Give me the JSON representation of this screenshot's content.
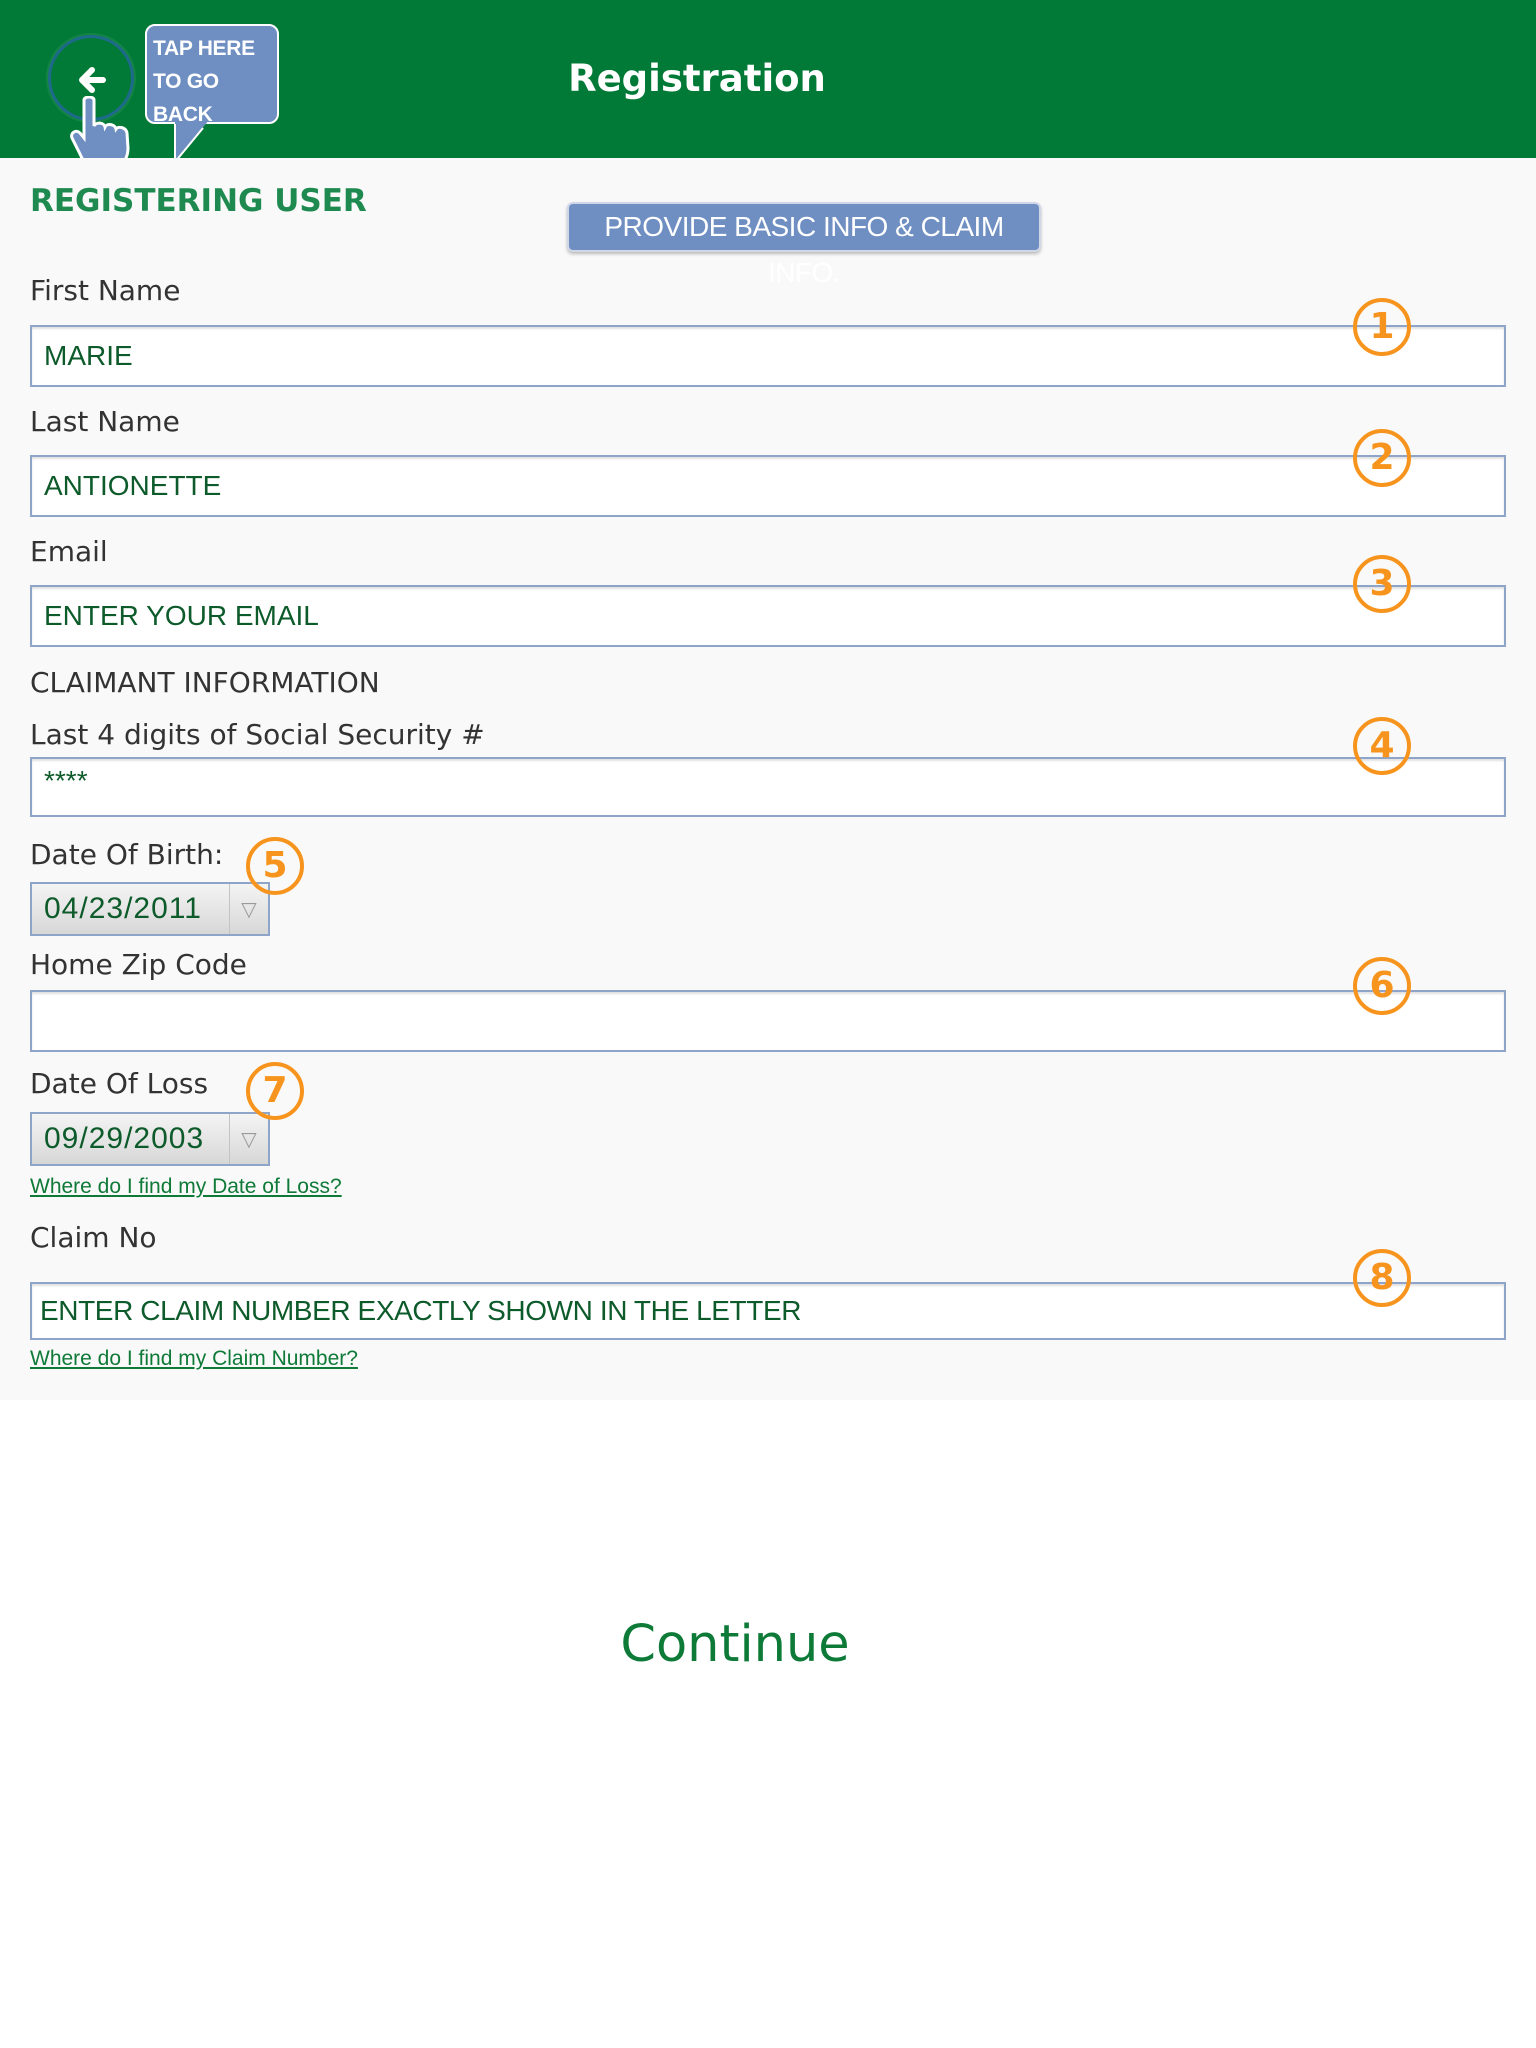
{
  "header": {
    "title": "Registration",
    "tooltip": "TAP HERE TO GO BACK"
  },
  "section_title": "REGISTERING USER",
  "banner": "PROVIDE BASIC INFO & CLAIM INFO.",
  "form": {
    "first_name": {
      "label": "First Name",
      "value": "MARIE",
      "badge": "1"
    },
    "last_name": {
      "label": "Last Name",
      "value": "ANTIONETTE",
      "badge": "2"
    },
    "email": {
      "label": "Email",
      "value": "ENTER YOUR EMAIL",
      "badge": "3"
    },
    "claimant_heading": "CLAIMANT INFORMATION",
    "ssn": {
      "label": "Last 4 digits of Social Security #",
      "value": "****",
      "badge": "4"
    },
    "dob": {
      "label": "Date Of Birth:",
      "value": "04/23/2011",
      "badge": "5"
    },
    "zip": {
      "label": "Home Zip Code",
      "value": "",
      "badge": "6"
    },
    "date_of_loss": {
      "label": "Date Of Loss",
      "value": "09/29/2003",
      "badge": "7",
      "help": "Where do I find my Date of Loss?"
    },
    "claim_no": {
      "label": "Claim No",
      "value": "ENTER CLAIM NUMBER EXACTLY SHOWN IN THE LETTER",
      "badge": "8",
      "help": "Where do I find my Claim Number?"
    }
  },
  "continue_label": "Continue",
  "colors": {
    "header_bg": "#007a36",
    "accent_green": "#1e8a50",
    "badge_orange": "#f7941d",
    "tooltip_blue": "#6f8fc2"
  },
  "icons": [
    "back-arrow-icon",
    "pointing-hand-icon",
    "dropdown-arrow-icon"
  ]
}
